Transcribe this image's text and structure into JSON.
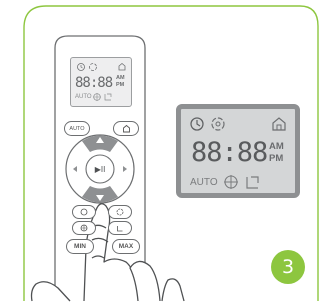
{
  "step_number": "3",
  "display": {
    "digits": "88:88",
    "am": "AM",
    "pm": "PM",
    "auto": "AUTO"
  },
  "remote": {
    "auto_button": "AUTO",
    "min_button": "MIN",
    "max_button": "MAX",
    "play_pause_symbol": "▶II"
  },
  "icons": [
    "clock-icon",
    "fan-spin-icon",
    "home-icon",
    "crosshair-icon",
    "room-corner-icon"
  ],
  "colors": {
    "frame_border": "#8dc63f",
    "badge": "#8dc63f",
    "dpad_arrows": "#8e9092",
    "lcd_background": "#d4d6d7"
  }
}
